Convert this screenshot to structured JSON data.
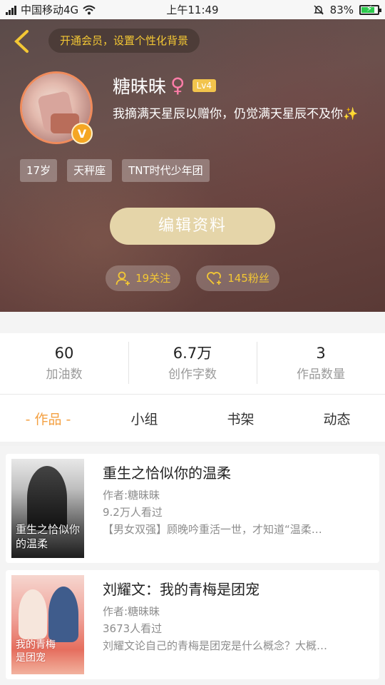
{
  "status_bar": {
    "carrier": "中国移动4G",
    "time": "上午11:49",
    "battery": "83%",
    "battery_level": 0.83
  },
  "header": {
    "back_icon": "chevron-left-icon",
    "vip_banner": "开通会员，设置个性化背景",
    "nickname": "糖昧昧",
    "gender_symbol": "♀",
    "level": "Lv4",
    "bio": "我摘满天星辰以赠你，仍觉满天星辰不及你✨",
    "verified_badge": "V",
    "tags": [
      "17岁",
      "天秤座",
      "TNT时代少年团"
    ],
    "edit_button": "编辑资料",
    "following": "19关注",
    "fans": "145粉丝"
  },
  "stats": [
    {
      "value": "60",
      "label": "加油数"
    },
    {
      "value": "6.7万",
      "label": "创作字数"
    },
    {
      "value": "3",
      "label": "作品数量"
    }
  ],
  "tabs": [
    {
      "label": "- 作品 -",
      "active": true
    },
    {
      "label": "小组",
      "active": false
    },
    {
      "label": "书架",
      "active": false
    },
    {
      "label": "动态",
      "active": false
    }
  ],
  "books": [
    {
      "title": "重生之恰似你的温柔",
      "author": "作者:糖昧昧",
      "views": "9.2万人看过",
      "desc": "【男女双强】顾晚吟重活一世，才知道“温柔…",
      "cover_text": "重生之恰似你的温柔"
    },
    {
      "title": "刘耀文：我的青梅是团宠",
      "author": "作者:糖昧昧",
      "views": "3673人看过",
      "desc": "刘耀文论自己的青梅是团宠是什么概念？大概…",
      "cover_text": "我的青梅是团宠"
    }
  ],
  "colors": {
    "accent": "#f4a041",
    "gold": "#f3c734",
    "edit_button": "#e5d5a9"
  }
}
